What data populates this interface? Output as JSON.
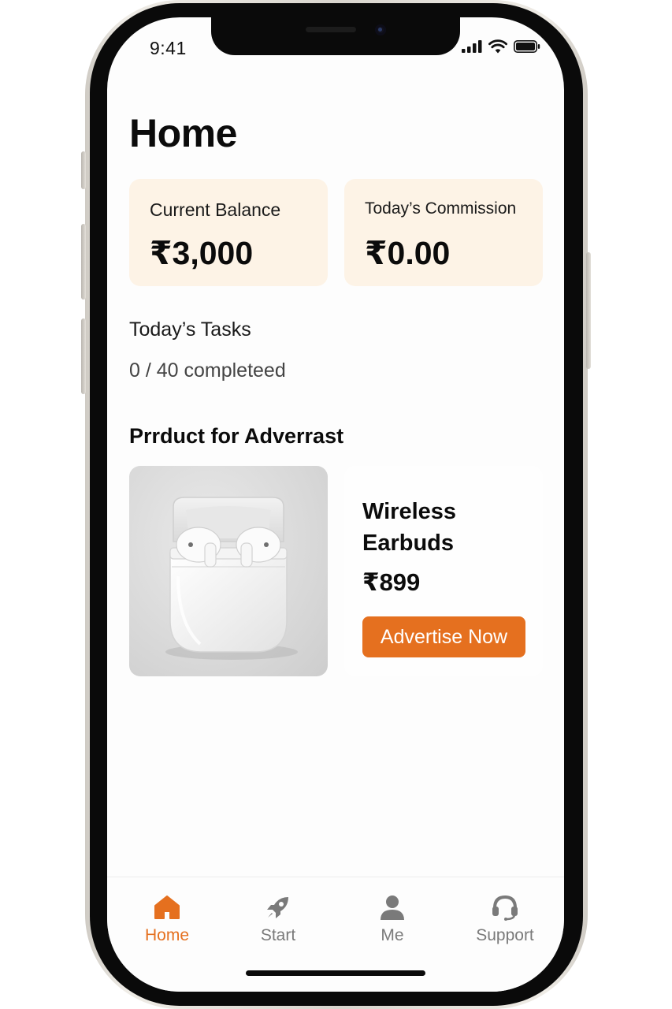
{
  "status_bar": {
    "time": "9:41"
  },
  "page": {
    "title": "Home"
  },
  "balance_card": {
    "label": "Current Balance",
    "value": "₹3,000"
  },
  "commission_card": {
    "label": "Today’s Commission",
    "value": "₹0.00"
  },
  "tasks": {
    "title": "Today’s Tasks",
    "progress": "0 / 40 completeed"
  },
  "product_section": {
    "title": "Prrduct for Adverrast",
    "product": {
      "name": "Wireless Earbuds",
      "price": "₹899",
      "button_label": "Advertise Now",
      "image_icon": "earbuds-image"
    }
  },
  "bottom_nav": {
    "items": [
      {
        "label": "Home",
        "icon": "home-icon",
        "active": true
      },
      {
        "label": "Start",
        "icon": "rocket-icon",
        "active": false
      },
      {
        "label": "Me",
        "icon": "person-icon",
        "active": false
      },
      {
        "label": "Support",
        "icon": "headset-icon",
        "active": false
      }
    ]
  },
  "colors": {
    "accent": "#e5701f",
    "card_background": "#fdf3e6",
    "text_primary": "#0b0b0b",
    "nav_inactive": "#7a7a7a"
  }
}
